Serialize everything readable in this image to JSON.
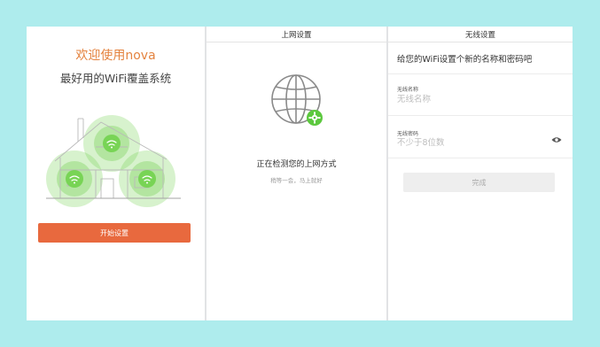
{
  "welcome": {
    "title": "欢迎使用nova",
    "subtitle": "最好用的WiFi覆盖系统",
    "start_button": "开始设置"
  },
  "internet_setup": {
    "title": "上网设置",
    "status": "正在检测您的上网方式",
    "hint": "稍等一会，马上就好"
  },
  "wireless_setup": {
    "title": "无线设置",
    "heading": "给您的WiFi设置个新的名称和密码吧",
    "name_label": "无线名称",
    "name_placeholder": "无线名称",
    "password_label": "无线密码",
    "password_placeholder": "不少于8位数",
    "done_button": "完成"
  },
  "colors": {
    "accent_orange": "#e8693e",
    "title_orange": "#e4833f",
    "node_green": "#6fcf4c",
    "background_cyan": "#aeeced"
  }
}
